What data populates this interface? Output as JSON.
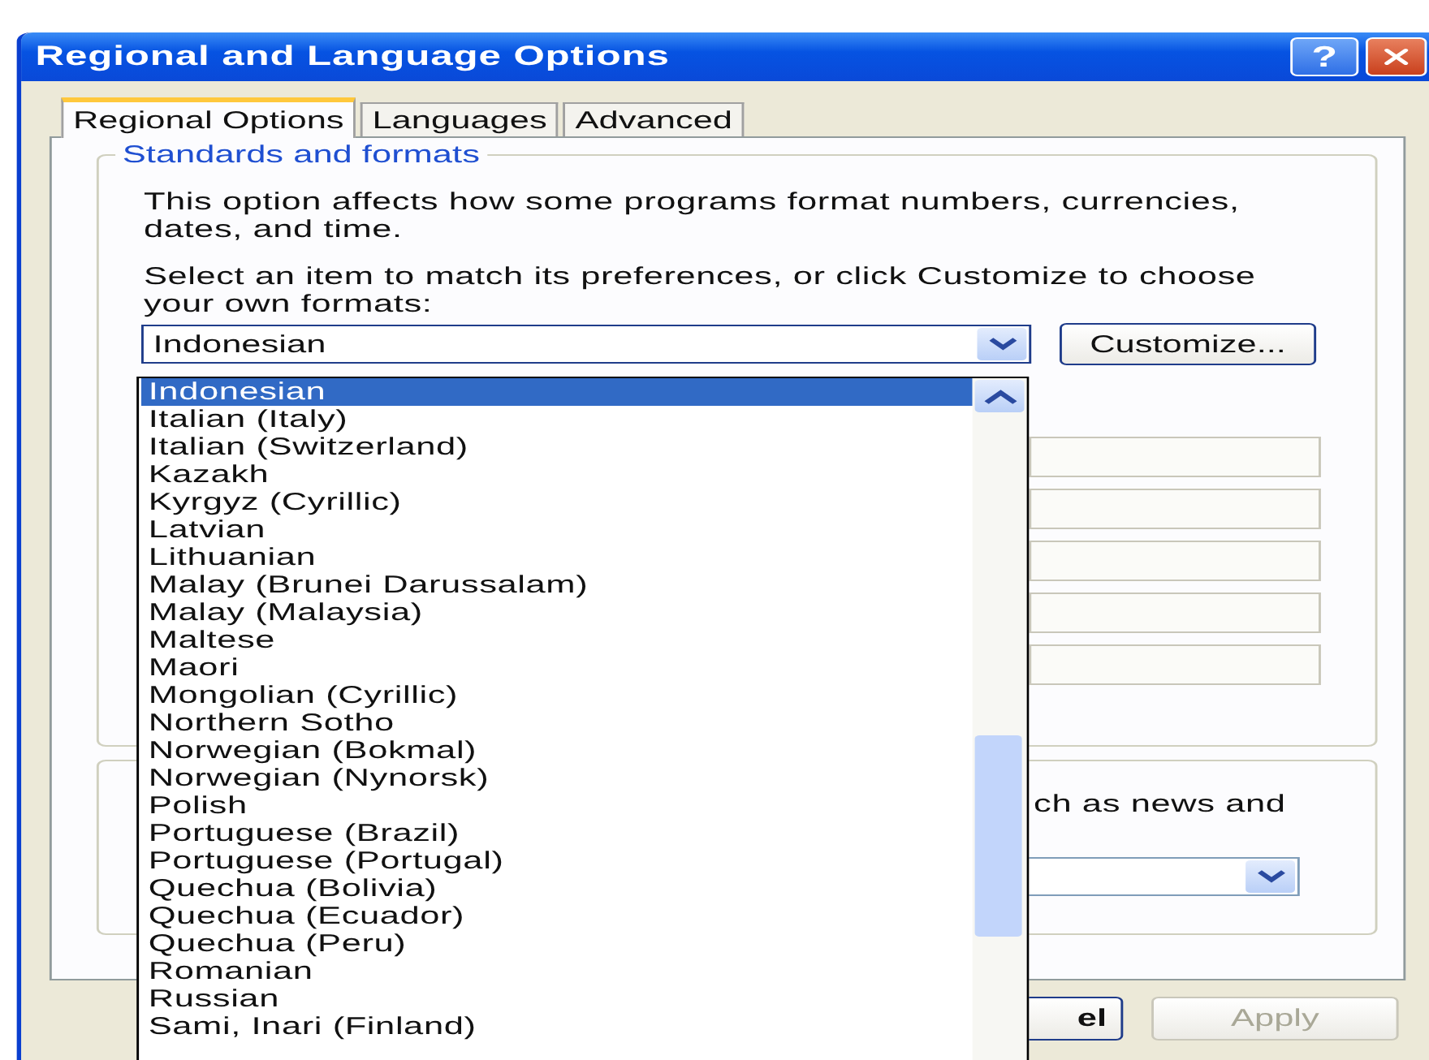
{
  "window": {
    "title": "Regional and Language Options",
    "help_button": "?"
  },
  "tabs": [
    {
      "label": "Regional Options",
      "selected": true
    },
    {
      "label": "Languages",
      "selected": false
    },
    {
      "label": "Advanced",
      "selected": false
    }
  ],
  "standards_group": {
    "title": "Standards and formats",
    "description": "This option affects how some programs format numbers, currencies, dates, and time.",
    "instruction": "Select an item to match its preferences, or click Customize to choose your own formats:",
    "format_combo": {
      "value": "Indonesian",
      "expanded": true
    },
    "customize_button": "Customize...",
    "list_items": [
      {
        "label": "Indonesian",
        "selected": true
      },
      {
        "label": "Italian (Italy)",
        "selected": false
      },
      {
        "label": "Italian (Switzerland)",
        "selected": false
      },
      {
        "label": "Kazakh",
        "selected": false
      },
      {
        "label": "Kyrgyz (Cyrillic)",
        "selected": false
      },
      {
        "label": "Latvian",
        "selected": false
      },
      {
        "label": "Lithuanian",
        "selected": false
      },
      {
        "label": "Malay (Brunei Darussalam)",
        "selected": false
      },
      {
        "label": "Malay (Malaysia)",
        "selected": false
      },
      {
        "label": "Maltese",
        "selected": false
      },
      {
        "label": "Maori",
        "selected": false
      },
      {
        "label": "Mongolian (Cyrillic)",
        "selected": false
      },
      {
        "label": "Northern Sotho",
        "selected": false
      },
      {
        "label": "Norwegian (Bokmal)",
        "selected": false
      },
      {
        "label": "Norwegian (Nynorsk)",
        "selected": false
      },
      {
        "label": "Polish",
        "selected": false
      },
      {
        "label": "Portuguese (Brazil)",
        "selected": false
      },
      {
        "label": "Portuguese (Portugal)",
        "selected": false
      },
      {
        "label": "Quechua (Bolivia)",
        "selected": false
      },
      {
        "label": "Quechua (Ecuador)",
        "selected": false
      },
      {
        "label": "Quechua (Peru)",
        "selected": false
      },
      {
        "label": "Romanian",
        "selected": false
      },
      {
        "label": "Russian",
        "selected": false
      },
      {
        "label": "Sami, Inari (Finland)",
        "selected": false
      }
    ]
  },
  "location_group": {
    "description": "ch as news and"
  },
  "buttons": [
    {
      "label": "el",
      "disabled": false
    },
    {
      "label": "Apply",
      "disabled": true
    }
  ]
}
